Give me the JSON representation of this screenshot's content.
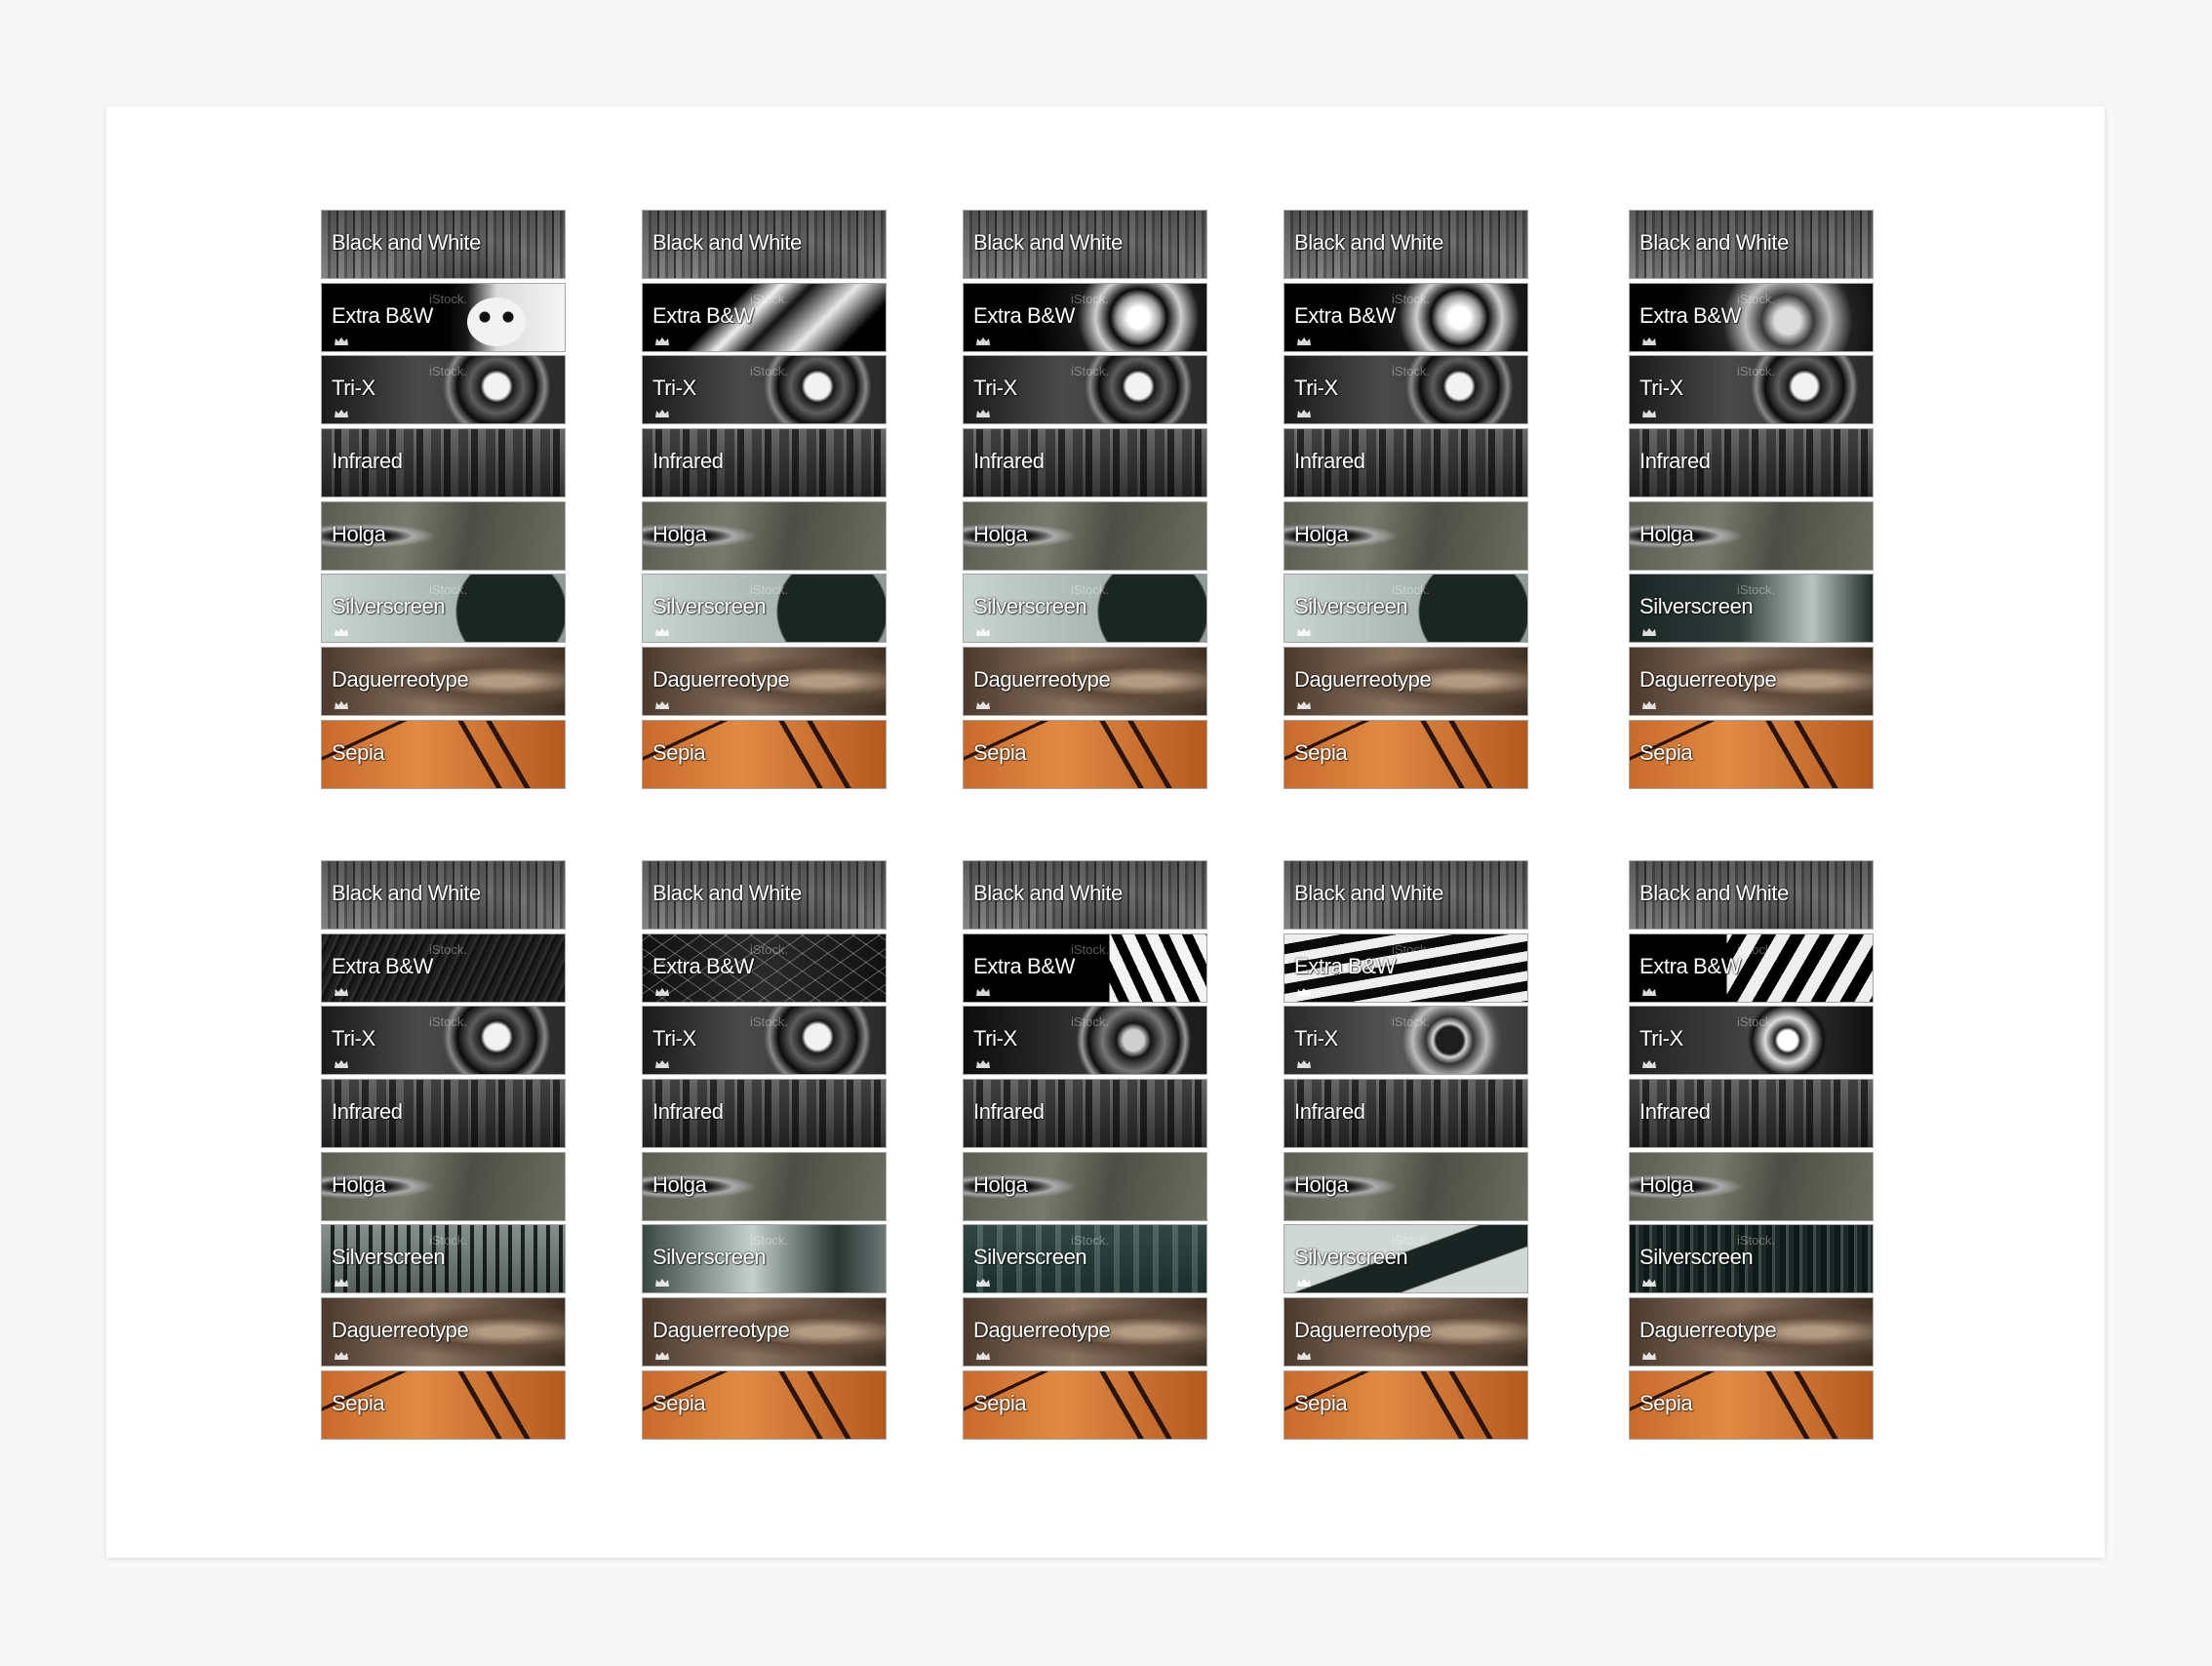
{
  "labels": {
    "bw": "Black and White",
    "xbw": "Extra B&W",
    "trix": "Tri-X",
    "ir": "Infrared",
    "holga": "Holga",
    "ss": "Silverscreen",
    "dag": "Daguerreotype",
    "sepia": "Sepia"
  },
  "watermark_text": "iStock.",
  "icons": {
    "crown": "crown-icon"
  },
  "colors": {
    "page": "#f7f7f7",
    "sheet": "#ffffff",
    "label": "#ffffff"
  }
}
